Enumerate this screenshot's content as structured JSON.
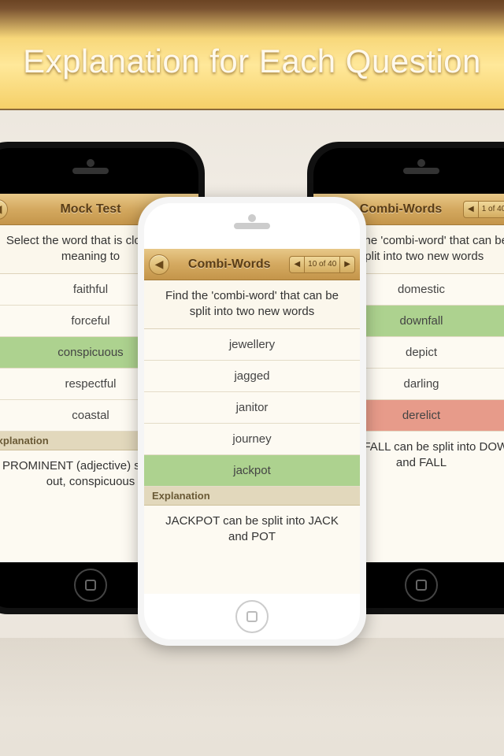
{
  "banner": {
    "title": "Explanation for Each Question"
  },
  "left": {
    "nav_title": "Mock Test",
    "question": "Select the word that is closest in meaning to",
    "options": [
      {
        "label": "faithful",
        "state": ""
      },
      {
        "label": "forceful",
        "state": ""
      },
      {
        "label": "conspicuous",
        "state": "correct"
      },
      {
        "label": "respectful",
        "state": ""
      },
      {
        "label": "coastal",
        "state": ""
      }
    ],
    "explain_header": "Explanation",
    "explain_body": "PROMINENT (adjective) standing out, conspicuous"
  },
  "right": {
    "nav_title": "Combi-Words",
    "pager": "1 of 40",
    "question": "Find the 'combi-word' that can be split into two new words",
    "options": [
      {
        "label": "domestic",
        "state": ""
      },
      {
        "label": "downfall",
        "state": "correct"
      },
      {
        "label": "depict",
        "state": ""
      },
      {
        "label": "darling",
        "state": ""
      },
      {
        "label": "derelict",
        "state": "wrong"
      }
    ],
    "explain_body": "DOWNFALL can be split into DOWN and FALL"
  },
  "center": {
    "nav_title": "Combi-Words",
    "pager": "10 of 40",
    "question": "Find the 'combi-word' that can be split into two new words",
    "options": [
      {
        "label": "jewellery",
        "state": ""
      },
      {
        "label": "jagged",
        "state": ""
      },
      {
        "label": "janitor",
        "state": ""
      },
      {
        "label": "journey",
        "state": ""
      },
      {
        "label": "jackpot",
        "state": "correct"
      }
    ],
    "explain_header": "Explanation",
    "explain_body": "JACKPOT can be split into JACK and POT"
  }
}
